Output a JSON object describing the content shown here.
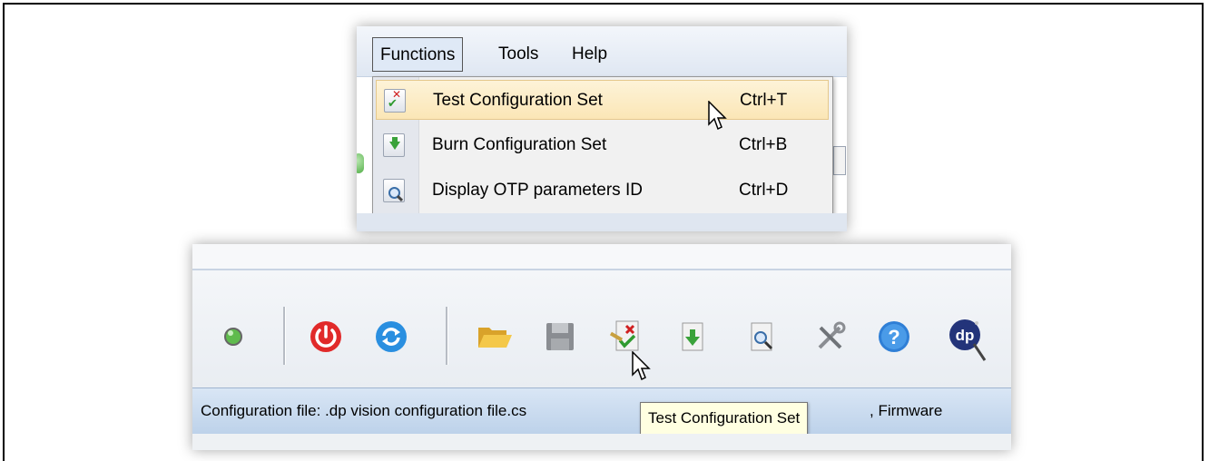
{
  "menubar": {
    "items": [
      "Functions",
      "Tools",
      "Help"
    ]
  },
  "functions_menu": {
    "items": [
      {
        "label": "Test Configuration Set",
        "shortcut": "Ctrl+T",
        "icon": "test-config-icon",
        "highlighted": true
      },
      {
        "label": "Burn Configuration Set",
        "shortcut": "Ctrl+B",
        "icon": "burn-config-icon",
        "highlighted": false
      },
      {
        "label": "Display OTP parameters ID",
        "shortcut": "Ctrl+D",
        "icon": "display-otp-icon",
        "highlighted": false
      }
    ]
  },
  "toolbar": {
    "buttons": [
      "status-led-icon",
      "power-icon",
      "refresh-icon",
      "open-folder-icon",
      "save-icon",
      "test-config-icon",
      "burn-config-icon",
      "display-otp-icon",
      "tools-icon",
      "help-icon",
      "dp-logo-icon"
    ]
  },
  "statusbar": {
    "text_left": "Configuration file: .dp vision configuration file.cs",
    "text_right": ", Firmware"
  },
  "tooltip": {
    "text": "Test Configuration Set"
  },
  "colors": {
    "menu_highlight": "#fbe6b6",
    "statusbar": "#c9dbef",
    "tooltip_bg": "#ffffe1"
  }
}
